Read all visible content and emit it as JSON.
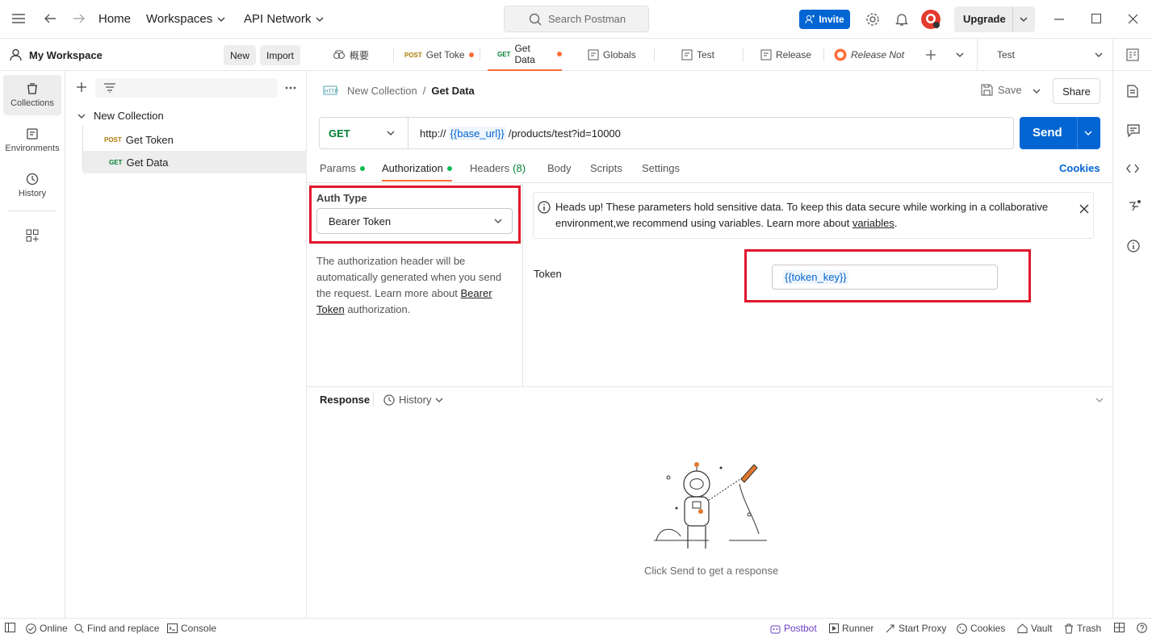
{
  "topbar": {
    "home": "Home",
    "workspaces": "Workspaces",
    "api_network": "API Network",
    "search_placeholder": "Search Postman",
    "invite": "Invite",
    "upgrade": "Upgrade"
  },
  "sidebar": {
    "workspace_name": "My Workspace",
    "new_btn": "New",
    "import_btn": "Import",
    "rail": [
      {
        "label": "Collections",
        "icon": "collections-icon"
      },
      {
        "label": "Environments",
        "icon": "environments-icon"
      },
      {
        "label": "History",
        "icon": "history-icon"
      }
    ],
    "collection_name": "New Collection",
    "requests": [
      {
        "method": "POST",
        "name": "Get Token"
      },
      {
        "method": "GET",
        "name": "Get Data"
      }
    ]
  },
  "tabs": {
    "items": [
      {
        "method": "",
        "label": "概要"
      },
      {
        "method": "POST",
        "label": "Get Toke"
      },
      {
        "method": "GET",
        "label": "Get Data"
      },
      {
        "method": "",
        "label": "Globals"
      },
      {
        "method": "",
        "label": "Test"
      },
      {
        "method": "",
        "label": "Release"
      },
      {
        "method": "",
        "label": "Release Not"
      }
    ],
    "environment": "Test"
  },
  "request": {
    "breadcrumb_parent": "New Collection",
    "breadcrumb_sep": "/",
    "breadcrumb_current": "Get Data",
    "save": "Save",
    "share": "Share",
    "method": "GET",
    "url_prefix": "http://",
    "url_var": "{{base_url}}",
    "url_suffix": "/products/test?id=10000",
    "send": "Send",
    "tabs": {
      "params": "Params",
      "authorization": "Authorization",
      "headers": "Headers",
      "headers_count": "(8)",
      "body": "Body",
      "scripts": "Scripts",
      "settings": "Settings",
      "cookies": "Cookies"
    }
  },
  "auth": {
    "auth_type_label": "Auth Type",
    "auth_type_value": "Bearer Token",
    "desc_1": "The authorization header will be automatically generated when you send the request. Learn more about",
    "desc_link": "Bearer Token",
    "desc_2": "authorization.",
    "notice_1": "Heads up! These parameters hold sensitive data. To keep this data secure while working in a collaborative environment,we recommend using variables. Learn more about",
    "notice_link": "variables",
    "notice_end": ".",
    "token_label": "Token",
    "token_value": "{{token_key}}"
  },
  "response": {
    "title": "Response",
    "history": "History",
    "empty": "Click Send to get a response"
  },
  "statusbar": {
    "online": "Online",
    "find_replace": "Find and replace",
    "console": "Console",
    "postbot": "Postbot",
    "runner": "Runner",
    "start_proxy": "Start Proxy",
    "cookies": "Cookies",
    "vault": "Vault",
    "trash": "Trash"
  },
  "colors": {
    "accent": "#0265d2",
    "highlight_box": "#e0182d",
    "post": "#ad7a03",
    "get": "#007f31",
    "unsaved_dot": "#ff6c37"
  }
}
